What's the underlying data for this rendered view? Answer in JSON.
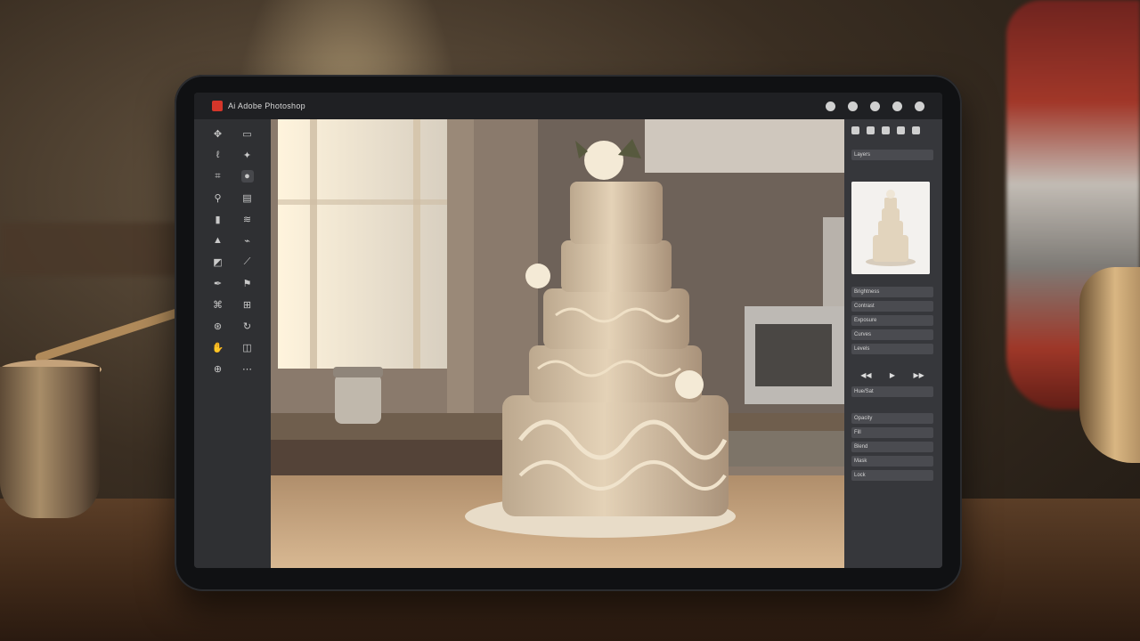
{
  "window": {
    "title": "Ai Adobe Photoshop"
  },
  "top_icons": [
    "cloud-icon",
    "search-icon",
    "share-icon",
    "user-icon",
    "help-icon"
  ],
  "toolbar": {
    "tools_left": [
      "move",
      "lasso",
      "crop",
      "eyedropper",
      "brush",
      "stamp",
      "gradient",
      "pen",
      "text",
      "shape",
      "hand",
      "zoom"
    ],
    "tools_right": [
      "select",
      "magic-wand",
      "heal",
      "eraser",
      "blur",
      "dodge",
      "path",
      "type",
      "rectangle",
      "rotate",
      "view",
      "extra"
    ]
  },
  "panel": {
    "layers_label": "Layers",
    "properties": [
      "Brightness",
      "Contrast",
      "Exposure"
    ],
    "adjust_rows": [
      "Curves",
      "Levels",
      "Hue/Sat"
    ],
    "bottom_rows": [
      "Opacity",
      "Fill",
      "Blend",
      "Mask",
      "Lock"
    ]
  }
}
